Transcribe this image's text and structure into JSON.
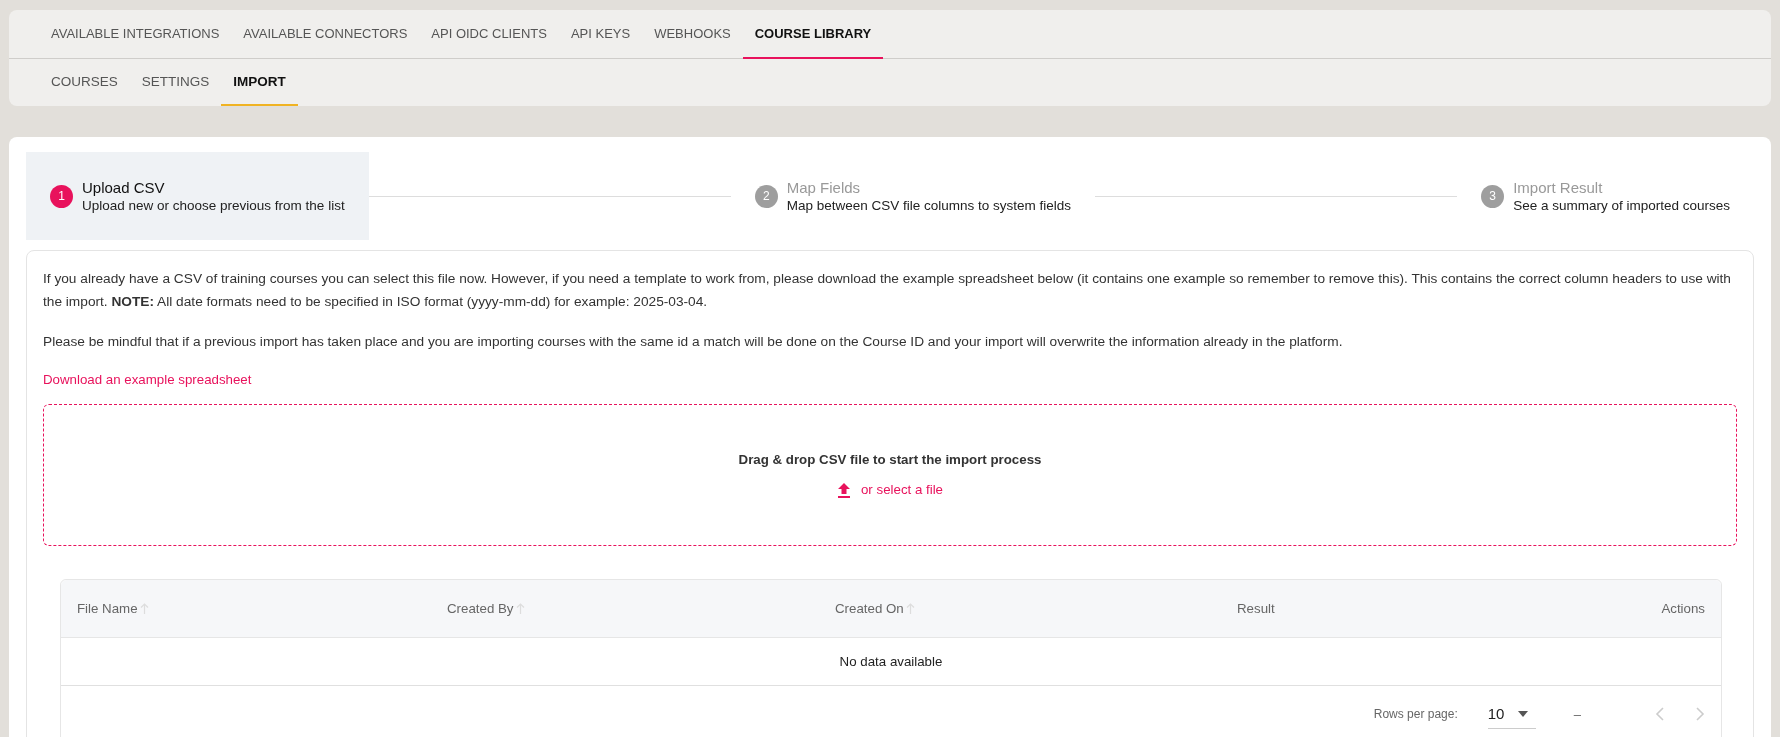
{
  "tabs": [
    {
      "label": "AVAILABLE INTEGRATIONS",
      "selected": false
    },
    {
      "label": "AVAILABLE CONNECTORS",
      "selected": false
    },
    {
      "label": "API OIDC CLIENTS",
      "selected": false
    },
    {
      "label": "API KEYS",
      "selected": false
    },
    {
      "label": "WEBHOOKS",
      "selected": false
    },
    {
      "label": "COURSE LIBRARY",
      "selected": true
    }
  ],
  "subtabs": [
    {
      "label": "COURSES",
      "selected": false
    },
    {
      "label": "SETTINGS",
      "selected": false
    },
    {
      "label": "IMPORT",
      "selected": true
    }
  ],
  "steps": [
    {
      "number": "1",
      "title": "Upload CSV",
      "subtitle": "Upload new or choose previous from the list",
      "selected": true
    },
    {
      "number": "2",
      "title": "Map Fields",
      "subtitle": "Map between CSV file columns to system fields",
      "selected": false
    },
    {
      "number": "3",
      "title": "Import Result",
      "subtitle": "See a summary of imported courses",
      "selected": false
    }
  ],
  "info": {
    "paragraphs": [
      "If you already have a CSV of training courses you can select this file now. However, if you need a template to work from, please download the example spreadsheet below (it contains one example so remember to remove this). This contains the correct column headers to use with the import. **NOTE:** All date formats need to be specified in ISO format (yyyy-mm-dd) for example: 2025-03-04.",
      "Please be mindful that if a previous import has taken place and you are importing courses with the same id a match will be done on the Course ID and your import will overwrite the information already in the platform."
    ],
    "link": "Download an example spreadsheet"
  },
  "dropzone": {
    "title": "Drag & drop CSV file to start the import process",
    "action": "or select a file"
  },
  "table": {
    "columns": [
      {
        "label": "File Name",
        "sortable": true
      },
      {
        "label": "Created By",
        "sortable": true
      },
      {
        "label": "Created On",
        "sortable": true
      },
      {
        "label": "Result",
        "sortable": false
      },
      {
        "label": "Actions",
        "sortable": false
      }
    ],
    "empty_text": "No data available",
    "footer": {
      "rows_per_page_label": "Rows per page:",
      "rows_per_page_value": "10",
      "range": "–",
      "prev_disabled": true,
      "next_disabled": true
    }
  }
}
